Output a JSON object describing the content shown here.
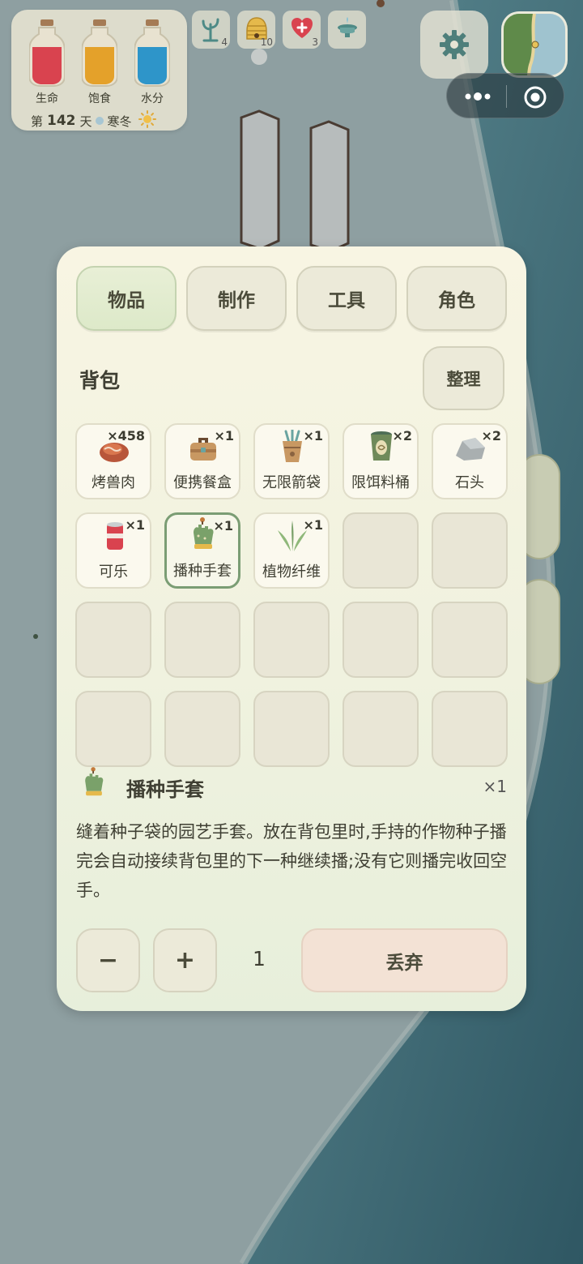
{
  "status": {
    "bars": [
      {
        "label": "生命",
        "color": "#d9434f",
        "level": 0.8,
        "icon": "health-bottle-icon"
      },
      {
        "label": "饱食",
        "color": "#e4a12a",
        "level": 0.8,
        "icon": "hunger-bottle-icon"
      },
      {
        "label": "水分",
        "color": "#2e95c9",
        "level": 0.8,
        "icon": "water-bottle-icon"
      }
    ],
    "day_prefix": "第",
    "day_number": "142",
    "day_suffix": "天",
    "season": "寒冬",
    "weather_icon": "sun-icon"
  },
  "buffs": [
    {
      "icon": "sprout-icon",
      "count": "4"
    },
    {
      "icon": "beehive-icon",
      "count": "10"
    },
    {
      "icon": "heart-plus-icon",
      "count": "3"
    },
    {
      "icon": "fountain-icon",
      "count": ""
    }
  ],
  "topbar": {
    "settings_icon": "gear-icon",
    "minimap_icon": "minimap",
    "capsule_more_icon": "more-dots-icon",
    "capsule_close_icon": "target-close-icon"
  },
  "inventory": {
    "tabs": [
      {
        "label": "物品",
        "active": true
      },
      {
        "label": "制作",
        "active": false
      },
      {
        "label": "工具",
        "active": false
      },
      {
        "label": "角色",
        "active": false
      }
    ],
    "section_title": "背包",
    "sort_label": "整理",
    "slots": [
      {
        "name": "烤兽肉",
        "qty": "×458",
        "icon": "roast-meat-icon"
      },
      {
        "name": "便携餐盒",
        "qty": "×1",
        "icon": "lunchbox-icon"
      },
      {
        "name": "无限箭袋",
        "qty": "×1",
        "icon": "quiver-icon"
      },
      {
        "name": "限饵料桶",
        "qty": "×2",
        "icon": "bait-bucket-icon"
      },
      {
        "name": "石头",
        "qty": "×2",
        "icon": "stone-icon"
      },
      {
        "name": "可乐",
        "qty": "×1",
        "icon": "cola-can-icon"
      },
      {
        "name": "播种手套",
        "qty": "×1",
        "icon": "seeding-glove-icon",
        "selected": true
      },
      {
        "name": "植物纤维",
        "qty": "×1",
        "icon": "plant-fiber-icon"
      },
      {},
      {},
      {},
      {},
      {},
      {},
      {},
      {},
      {},
      {},
      {},
      {}
    ],
    "detail": {
      "icon": "seeding-glove-icon",
      "name": "播种手套",
      "qty": "×1",
      "description": "缝着种子袋的园艺手套。放在背包里时,手持的作物种子播完会自动接续背包里的下一种继续播;没有它则播完收回空手。"
    },
    "controls": {
      "minus_label": "−",
      "plus_label": "+",
      "amount": "1",
      "discard_label": "丢弃"
    }
  }
}
